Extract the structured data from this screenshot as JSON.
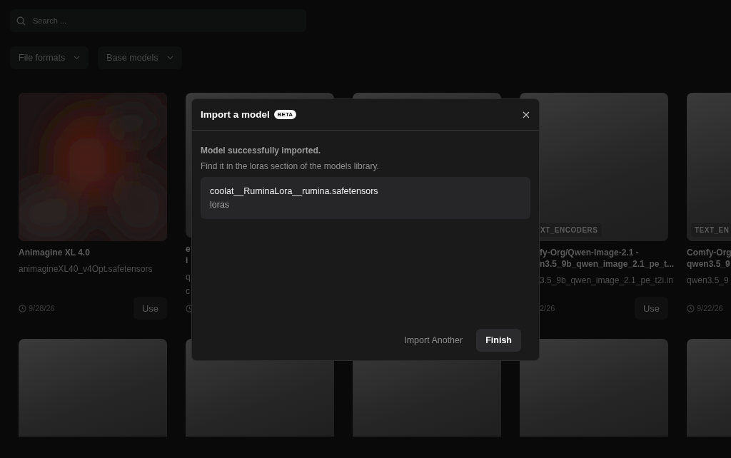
{
  "search": {
    "placeholder": "Search ..."
  },
  "filters": [
    "File formats",
    "Base models"
  ],
  "cards": [
    {
      "kind": "picture",
      "title_lines": [
        "Animagine XL 4.0"
      ],
      "filename": "animagineXL40_v4Opt.safetensors",
      "clock": true,
      "date": "9/28/26",
      "use": "Use"
    },
    {
      "kind": "plain",
      "title_lines": [
        "e",
        "i"
      ],
      "filename_lines": [
        "q",
        "c"
      ],
      "clock": true
    },
    {
      "kind": "plain"
    },
    {
      "kind": "cut-left",
      "badge": "XT_ENCODERS",
      "title_lines": [
        "fy-Org/Qwen-Image-2.1 -",
        "n3.5_9b_qwen_image_2.1_pe_t..."
      ],
      "filename": "3.5_9b_qwen_image_2.1_pe_t2i.in",
      "date": "2/26",
      "use": "Use"
    },
    {
      "kind": "plain",
      "badge": "TEXT_EN",
      "title_lines": [
        "Comfy-Org",
        "qwen3.5_9"
      ],
      "filename": "qwen3.5_9",
      "clock": true,
      "date": "9/22/26"
    }
  ],
  "second_row": [
    {
      "kind": "plain"
    },
    {
      "kind": "plain"
    },
    {
      "kind": "plain"
    },
    {
      "kind": "plain"
    },
    {
      "kind": "plain"
    }
  ],
  "dialog": {
    "title": "Import a model",
    "badge": "BETA",
    "message": "Model successfully imported.",
    "hint": "Find it in the loras section of the models library.",
    "result": {
      "filename": "coolat__RuminaLora__rumina.safetensors",
      "folder": "loras"
    },
    "buttons": [
      {
        "kind": "text",
        "label": "Import Another"
      },
      {
        "kind": "primary",
        "label": "Finish"
      }
    ]
  }
}
